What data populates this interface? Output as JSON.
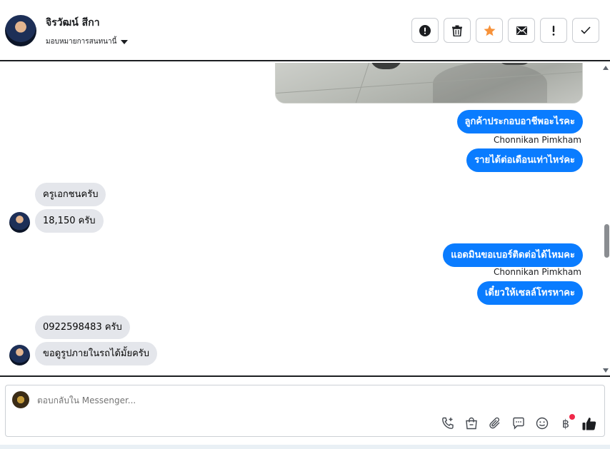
{
  "header": {
    "contact_name": "จิรวัฒน์ สีกา",
    "assign_label": "มอบหมายการสนทนานี้",
    "actions": [
      {
        "icon": "alert-circle-icon",
        "label": "Mark as spam"
      },
      {
        "icon": "trash-icon",
        "label": "Delete"
      },
      {
        "icon": "star-icon",
        "label": "Star",
        "color": "#f7923a"
      },
      {
        "icon": "envelope-icon",
        "label": "Mark as unread"
      },
      {
        "icon": "exclamation-icon",
        "label": "Follow up"
      },
      {
        "icon": "check-icon",
        "label": "Mark as done"
      }
    ]
  },
  "messages": [
    {
      "side": "out",
      "text": "ลูกค้าประกอบอาชีพอะไรคะ"
    },
    {
      "sender": "Chonnikan Pimkham"
    },
    {
      "side": "out",
      "text": "รายได้ต่อเดือนเท่าไหร่คะ"
    },
    {
      "side": "in",
      "text": "ครูเอกชนครับ"
    },
    {
      "side": "in",
      "text": "18,150 ครับ"
    },
    {
      "side": "out",
      "text": "แอดมินขอเบอร์ติดต่อได้ไหมคะ"
    },
    {
      "sender": "Chonnikan Pimkham"
    },
    {
      "side": "out",
      "text": "เดี๋ยวให้เซลล์โทรหาคะ"
    },
    {
      "side": "in",
      "text": "0922598483 ครับ"
    },
    {
      "side": "in",
      "text": "ขอดูรูปภายในรถได้มั้ยครับ"
    }
  ],
  "composer": {
    "placeholder": "ตอบกลับใน Messenger...",
    "tools": [
      "phone-plus-icon",
      "shopping-bag-icon",
      "paperclip-icon",
      "saved-reply-icon",
      "emoji-icon",
      "baht-payment-icon",
      "thumbs-up-icon"
    ],
    "baht_symbol": "฿"
  },
  "colors": {
    "accent": "#0a7cff",
    "incoming_bubble": "#e4e6eb",
    "star": "#f7923a",
    "notification_dot": "#f02849"
  }
}
